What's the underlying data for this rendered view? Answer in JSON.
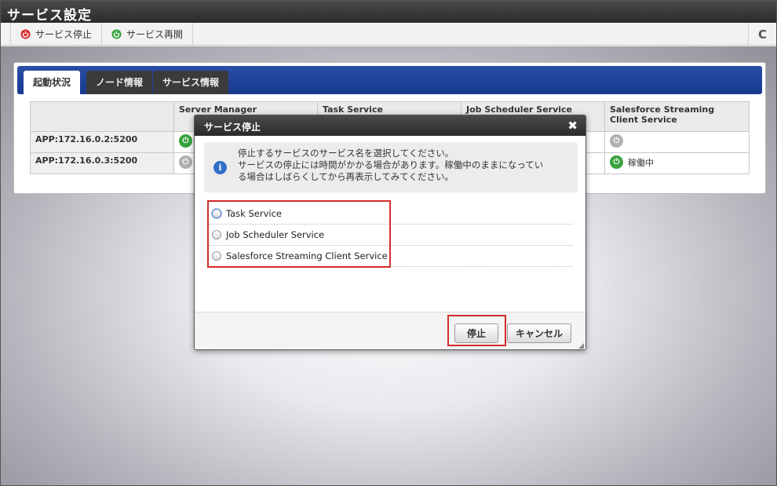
{
  "app": {
    "title": "サービス設定"
  },
  "toolbar": {
    "stop_label": "サービス停止",
    "restart_label": "サービス再開",
    "refresh_icon": "C"
  },
  "tabs": [
    {
      "label": "起動状況",
      "active": true
    },
    {
      "label": "ノード情報",
      "active": false
    },
    {
      "label": "サービス情報",
      "active": false
    }
  ],
  "table": {
    "headers": [
      "",
      "Server Manager",
      "Task Service",
      "Job Scheduler Service",
      "Salesforce Streaming Client Service"
    ],
    "rows": [
      {
        "host": "APP:172.16.0.2:5200"
      },
      {
        "host": "APP:172.16.0.3:5200",
        "sfs_status": "稼働中"
      }
    ]
  },
  "dialog": {
    "title": "サービス停止",
    "info_lines": [
      "停止するサービスのサービス名を選択してください。",
      "サービスの停止には時間がかかる場合があります。稼働中のままになってい",
      "る場合はしばらくしてから再表示してみてください。"
    ],
    "options": [
      "Task Service",
      "Job Scheduler Service",
      "Salesforce Streaming Client Service"
    ],
    "stop_label": "停止",
    "cancel_label": "キャンセル"
  },
  "colors": {
    "accent_blue": "#1f4399",
    "status_green": "#39a23c",
    "highlight_red": "#d32c2c"
  }
}
